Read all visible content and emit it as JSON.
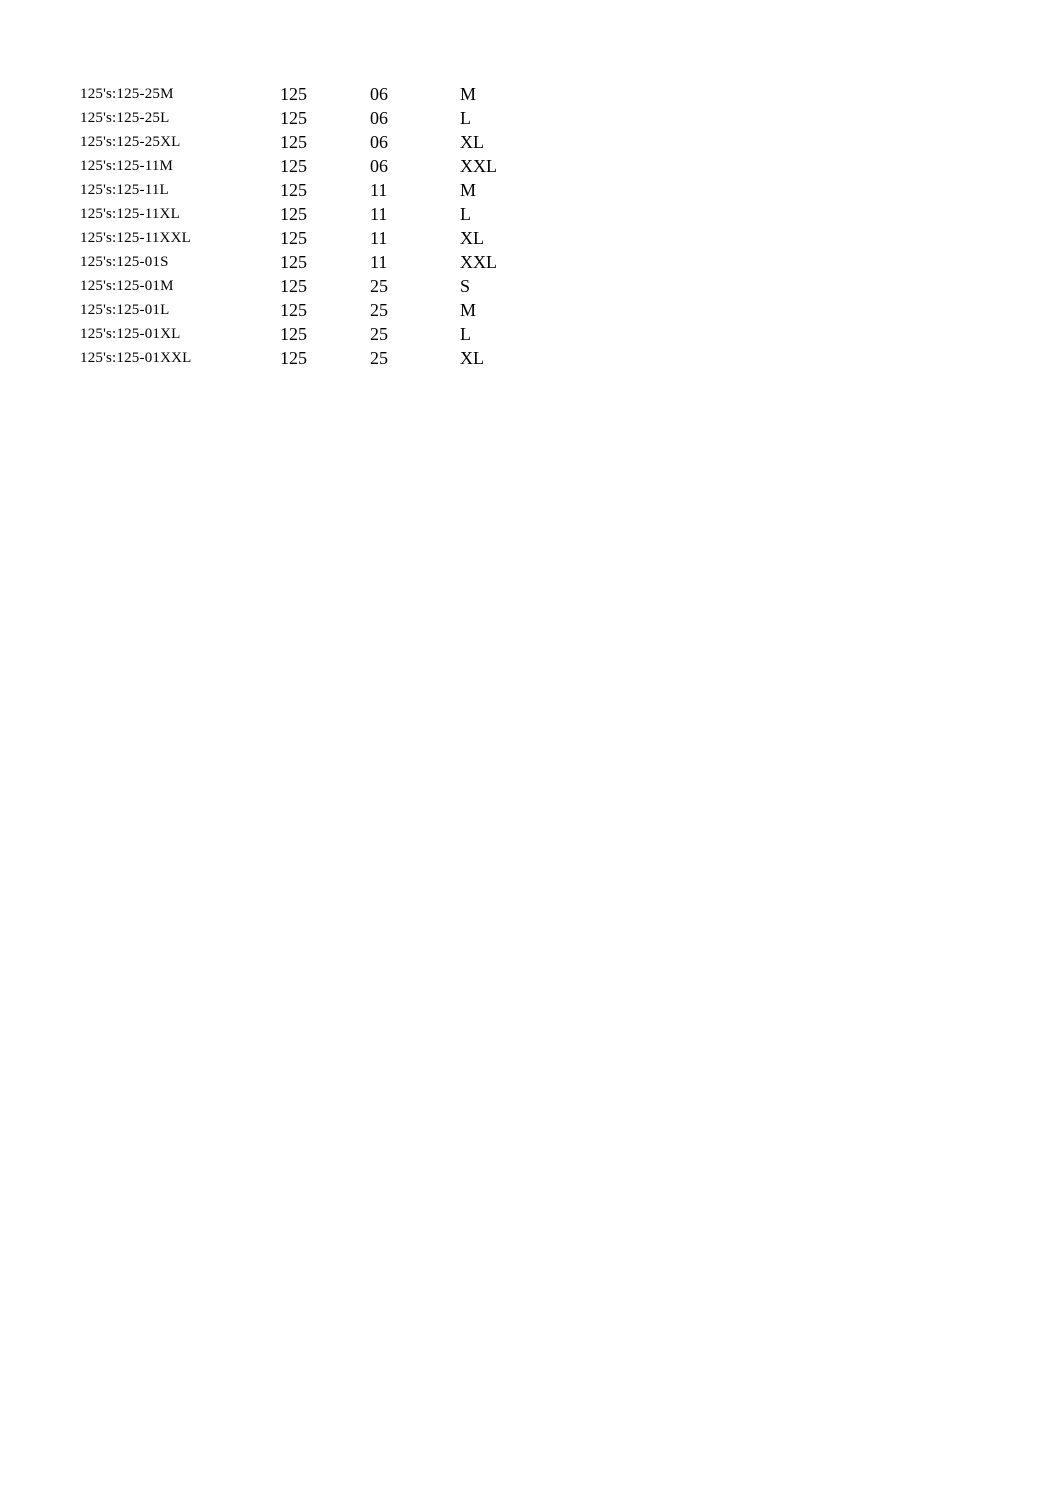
{
  "rows": [
    {
      "label": "125's:125-25M",
      "c1": "125",
      "c2": "06",
      "c3": "M"
    },
    {
      "label": "125's:125-25L",
      "c1": "125",
      "c2": "06",
      "c3": "L"
    },
    {
      "label": "125's:125-25XL",
      "c1": "125",
      "c2": "06",
      "c3": "XL"
    },
    {
      "label": "125's:125-11M",
      "c1": "125",
      "c2": "06",
      "c3": "XXL"
    },
    {
      "label": "125's:125-11L",
      "c1": "125",
      "c2": "11",
      "c3": "M"
    },
    {
      "label": "125's:125-11XL",
      "c1": "125",
      "c2": "11",
      "c3": "L"
    },
    {
      "label": "125's:125-11XXL",
      "c1": "125",
      "c2": "11",
      "c3": "XL"
    },
    {
      "label": "125's:125-01S",
      "c1": "125",
      "c2": "11",
      "c3": "XXL"
    },
    {
      "label": "125's:125-01M",
      "c1": "125",
      "c2": "25",
      "c3": "S"
    },
    {
      "label": "125's:125-01L",
      "c1": "125",
      "c2": "25",
      "c3": "M"
    },
    {
      "label": "125's:125-01XL",
      "c1": "125",
      "c2": "25",
      "c3": "L"
    },
    {
      "label": "125's:125-01XXL",
      "c1": "125",
      "c2": "25",
      "c3": "XL"
    }
  ]
}
